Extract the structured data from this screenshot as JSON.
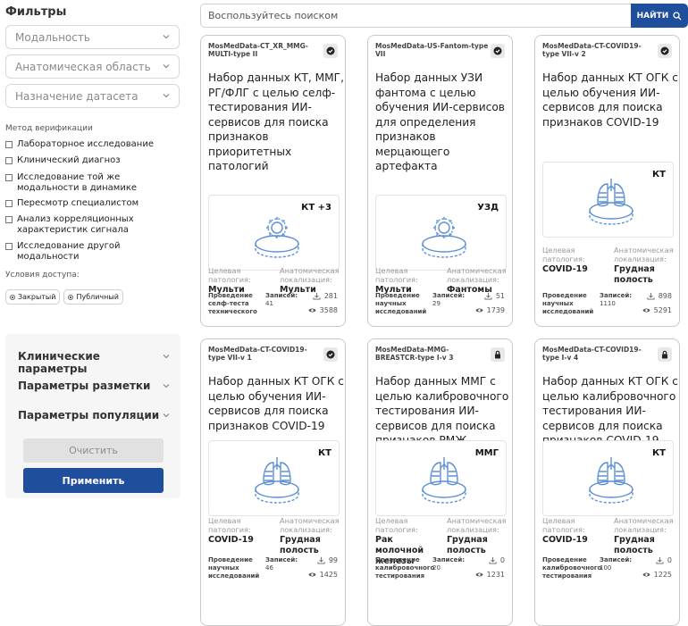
{
  "sidebar": {
    "title": "Фильтры",
    "selects": [
      {
        "placeholder": "Модальность"
      },
      {
        "placeholder": "Анатомическая область"
      },
      {
        "placeholder": "Назначение датасета"
      }
    ],
    "verification_label": "Метод верификации",
    "verification_options": [
      "Лабораторное исследование",
      "Клинический диагноз",
      "Исследование той же модальности в динамике",
      "Пересмотр специалистом",
      "Анализ корреляционных характеристик сигнала",
      "Исследование другой модальности"
    ],
    "access_label": "Условия доступа:",
    "access_options": [
      "Закрытый",
      "Публичный"
    ],
    "params": [
      "Клинические параметры",
      "Параметры разметки",
      "Параметры популяции"
    ],
    "clear_label": "Очистить",
    "apply_label": "Применить"
  },
  "search": {
    "placeholder": "Воспользуйтесь поиском",
    "button_label": "НАЙТИ"
  },
  "meta_labels": {
    "pathology": "Целевая патология:",
    "anatomy": "Анатомическая локализация:",
    "records": "Записей:"
  },
  "colors": {
    "accent": "#1f4e9c",
    "illustration": "#5b8fd6"
  },
  "cards": [
    {
      "code": "MosMedData-CT_XR_MMG-MULTI-type II",
      "badge": "check",
      "title": "Набор данных КТ, ММГ, РГ/ФЛГ с целью селф-тестирования ИИ-сервисов для поиска признаков приоритетных патологий",
      "modality": "КТ +3",
      "icon": "gear-icon",
      "pathology": "Мульти",
      "anatomy": "Мульти",
      "purpose": "Проведение селф-теста технического",
      "records": "41",
      "downloads": "281",
      "views": "3588"
    },
    {
      "code": "MosMedData-US-Fantom-type VII",
      "badge": "check",
      "title": "Набор данных УЗИ фантома с целью обучения ИИ-сервисов для определения признаков мерцающего артефакта",
      "modality": "УЗД",
      "icon": "gear-icon",
      "pathology": "Мульти",
      "anatomy": "Фантомы",
      "purpose": "Проведение научных исследований",
      "records": "29",
      "downloads": "51",
      "views": "1739"
    },
    {
      "code": "MosMedData-CT-COVID19-type VII-v 2",
      "badge": "check",
      "title": "Набор данных КТ ОГК с целью обучения ИИ-сервисов для поиска признаков COVID-19",
      "modality": "КТ",
      "icon": "lungs-icon",
      "pathology": "COVID-19",
      "anatomy": "Грудная полость",
      "purpose": "Проведение научных исследований",
      "records": "1110",
      "downloads": "898",
      "views": "5291"
    },
    {
      "code": "MosMedData-CT-COVID19-type VII-v 1",
      "badge": "check",
      "title": "Набор данных КТ ОГК с целью обучения ИИ-сервисов для поиска признаков COVID-19",
      "modality": "КТ",
      "icon": "lungs-icon",
      "pathology": "COVID-19",
      "anatomy": "Грудная полость",
      "purpose": "Проведение научных исследований",
      "records": "46",
      "downloads": "99",
      "views": "1425"
    },
    {
      "code": "MosMedData-MMG-BREASTCR-type I-v 3",
      "badge": "lock",
      "title": "Набор данных ММГ с целью калибровочного тестирования ИИ-сервисов для поиска признаков РМЖ",
      "modality": "ММГ",
      "icon": "breast-icon",
      "pathology": "Рак молочной железы",
      "anatomy": "Грудная полость",
      "purpose": "Проведение калибровочного тестирования",
      "records": "20",
      "downloads": "0",
      "views": "1231"
    },
    {
      "code": "MosMedData-CT-COVID19-type I-v 4",
      "badge": "lock",
      "title": "Набор данных КТ ОГК с целью калибровочного тестирования ИИ-сервисов для поиска признаков COVID-19",
      "modality": "КТ",
      "icon": "lungs-icon",
      "pathology": "COVID-19",
      "anatomy": "Грудная полость",
      "purpose": "Проведение калибровочного тестирования",
      "records": "100",
      "downloads": "0",
      "views": "1225"
    }
  ]
}
